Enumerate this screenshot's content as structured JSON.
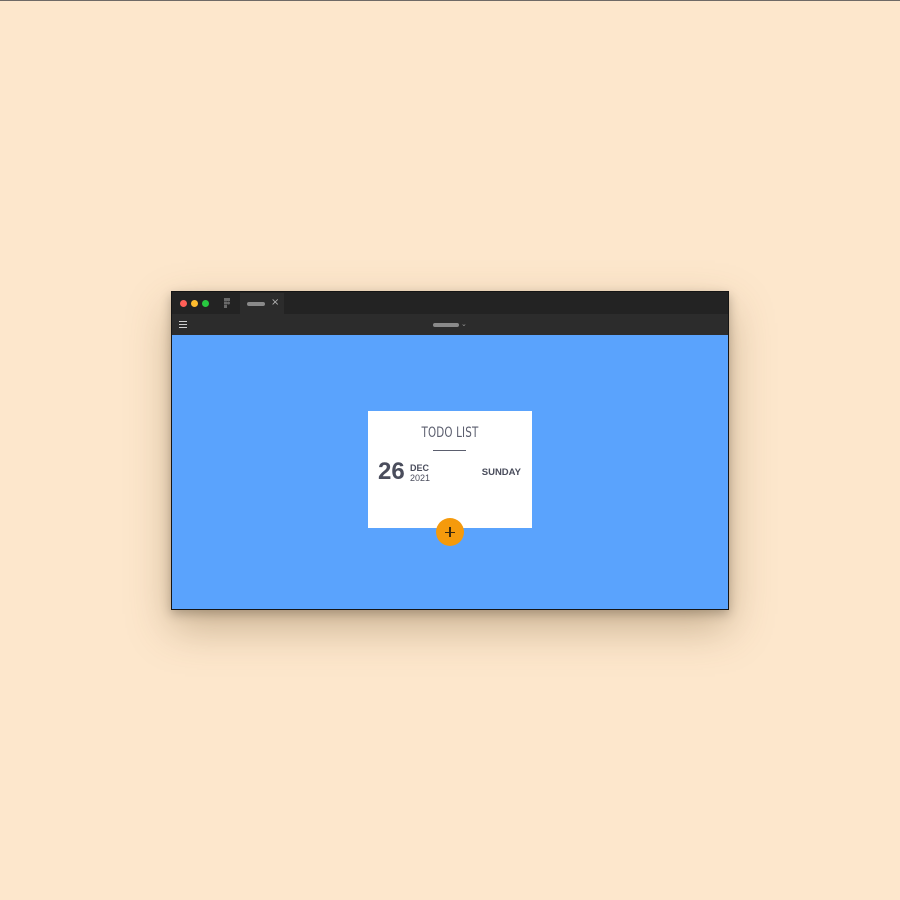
{
  "window": {
    "tab": {
      "close_glyph": "×"
    },
    "toolbar": {
      "file_menu_glyph": "⌄"
    }
  },
  "todo_card": {
    "title": "TODO LIST",
    "date": {
      "day": "26",
      "month": "DEC",
      "year": "2021",
      "weekday": "SUNDAY"
    }
  },
  "add_button": {
    "icon": "plus-icon"
  },
  "colors": {
    "page_background": "#fde7cc",
    "canvas_background": "#5aa3fd",
    "card_background": "#ffffff",
    "accent": "#f59a0c",
    "text": "#4a4d5c"
  },
  "icons": [
    "figma-icon",
    "close-icon",
    "menu-icon",
    "chevron-down-icon",
    "plus-icon"
  ]
}
